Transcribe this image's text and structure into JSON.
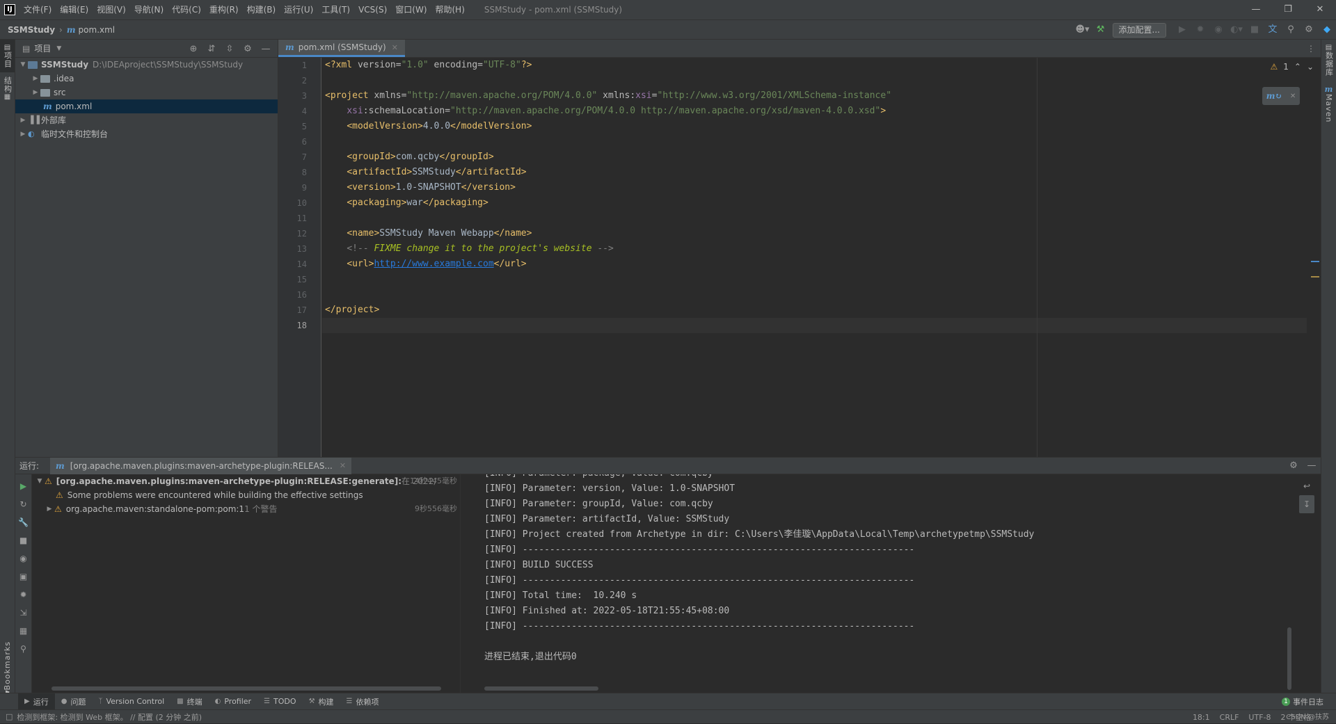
{
  "menu": {
    "items": [
      "文件(F)",
      "编辑(E)",
      "视图(V)",
      "导航(N)",
      "代码(C)",
      "重构(R)",
      "构建(B)",
      "运行(U)",
      "工具(T)",
      "VCS(S)",
      "窗口(W)",
      "帮助(H)"
    ],
    "window_title": "SSMStudy - pom.xml (SSMStudy)"
  },
  "navbar": {
    "project": "SSMStudy",
    "file": "pom.xml",
    "add_config_label": "添加配置..."
  },
  "left_stripe": {
    "project_label": "项目",
    "structure_label": "结构",
    "bookmarks_label": "Bookmarks"
  },
  "right_stripe": {
    "database_label": "数据库",
    "maven_label": "Maven"
  },
  "project_panel": {
    "title": "项目",
    "tree": {
      "root_name": "SSMStudy",
      "root_path": "D:\\IDEAproject\\SSMStudy\\SSMStudy",
      "idea": ".idea",
      "src": "src",
      "pom": "pom.xml",
      "external_libs": "外部库",
      "scratches": "临时文件和控制台"
    }
  },
  "editor": {
    "tab_label": "pom.xml (SSMStudy)",
    "warning_count": "1",
    "line_numbers": [
      "1",
      "2",
      "3",
      "4",
      "5",
      "6",
      "7",
      "8",
      "9",
      "10",
      "11",
      "12",
      "13",
      "14",
      "15",
      "16",
      "17",
      "18"
    ],
    "code": {
      "l1_decl_open": "<?xml",
      "l1_version_attr": " version=",
      "l1_version_val": "\"1.0\"",
      "l1_encoding_attr": " encoding=",
      "l1_encoding_val": "\"UTF-8\"",
      "l1_decl_close": "?>",
      "l3_open": "<project",
      "l3_xmlns_attr": " xmlns=",
      "l3_xmlns_val": "\"http://maven.apache.org/POM/4.0.0\"",
      "l3_xmlns_prefix": " xmlns:",
      "l3_xsi_ns": "xsi",
      "l3_eq": "=",
      "l3_xsi_val": "\"http://www.w3.org/2001/XMLSchema-instance\"",
      "l4_xsi": "xsi",
      "l4_attr": ":schemaLocation=",
      "l4_val": "\"http://maven.apache.org/POM/4.0.0 http://maven.apache.org/xsd/maven-4.0.0.xsd\"",
      "l4_close": ">",
      "l5_open": "<modelVersion>",
      "l5_text": "4.0.0",
      "l5_close": "</modelVersion>",
      "l7_open": "<groupId>",
      "l7_text": "com.qcby",
      "l7_close": "</groupId>",
      "l8_open": "<artifactId>",
      "l8_text": "SSMStudy",
      "l8_close": "</artifactId>",
      "l9_open": "<version>",
      "l9_text": "1.0-SNAPSHOT",
      "l9_close": "</version>",
      "l10_open": "<packaging>",
      "l10_text": "war",
      "l10_close": "</packaging>",
      "l12_open": "<name>",
      "l12_text": "SSMStudy Maven Webapp",
      "l12_close": "</name>",
      "l13_cmt_open": "<!-- ",
      "l13_todo": "FIXME change it to the project's website",
      "l13_cmt_close": " -->",
      "l14_open": "<url>",
      "l14_link": "http://www.example.com",
      "l14_close": "</url>",
      "l17_close": "</project>"
    }
  },
  "run_panel": {
    "label": "运行:",
    "tab_label": "[org.apache.maven.plugins:maven-archetype-plugin:RELEAS...",
    "tree": {
      "root_label": "[org.apache.maven.plugins:maven-archetype-plugin:RELEASE:generate]:",
      "root_suffix": " 在 2022/",
      "root_time": "14秒445毫秒",
      "child1": "Some problems were encountered while building the effective settings",
      "child2": "org.apache.maven:standalone-pom:pom:1",
      "child2_suffix": " 1 个警告",
      "child2_time": "9秒556毫秒"
    },
    "console": [
      "[INFO] Parameter: package, Value: com.qcby",
      "[INFO] Parameter: version, Value: 1.0-SNAPSHOT",
      "[INFO] Parameter: groupId, Value: com.qcby",
      "[INFO] Parameter: artifactId, Value: SSMStudy",
      "[INFO] Project created from Archetype in dir: C:\\Users\\李佳璇\\AppData\\Local\\Temp\\archetypetmp\\SSMStudy",
      "[INFO] ------------------------------------------------------------------------",
      "[INFO] BUILD SUCCESS",
      "[INFO] ------------------------------------------------------------------------",
      "[INFO] Total time:  10.240 s",
      "[INFO] Finished at: 2022-05-18T21:55:45+08:00",
      "[INFO] ------------------------------------------------------------------------",
      "",
      "进程已结束,退出代码0"
    ]
  },
  "tool_windows": {
    "run": "运行",
    "problems": "问题",
    "vcs": "Version Control",
    "terminal": "终端",
    "profiler": "Profiler",
    "todo": "TODO",
    "build": "构建",
    "dependencies": "依赖项",
    "event_log": "事件日志",
    "event_log_count": "1"
  },
  "status": {
    "message": "检测到框架: 检测到 Web 框架。 // 配置 (2 分钟 之前)",
    "position": "18:1",
    "line_sep": "CRLF",
    "encoding": "UTF-8",
    "indent": "2 个空格",
    "watermark": "CSDN @扶苏"
  }
}
